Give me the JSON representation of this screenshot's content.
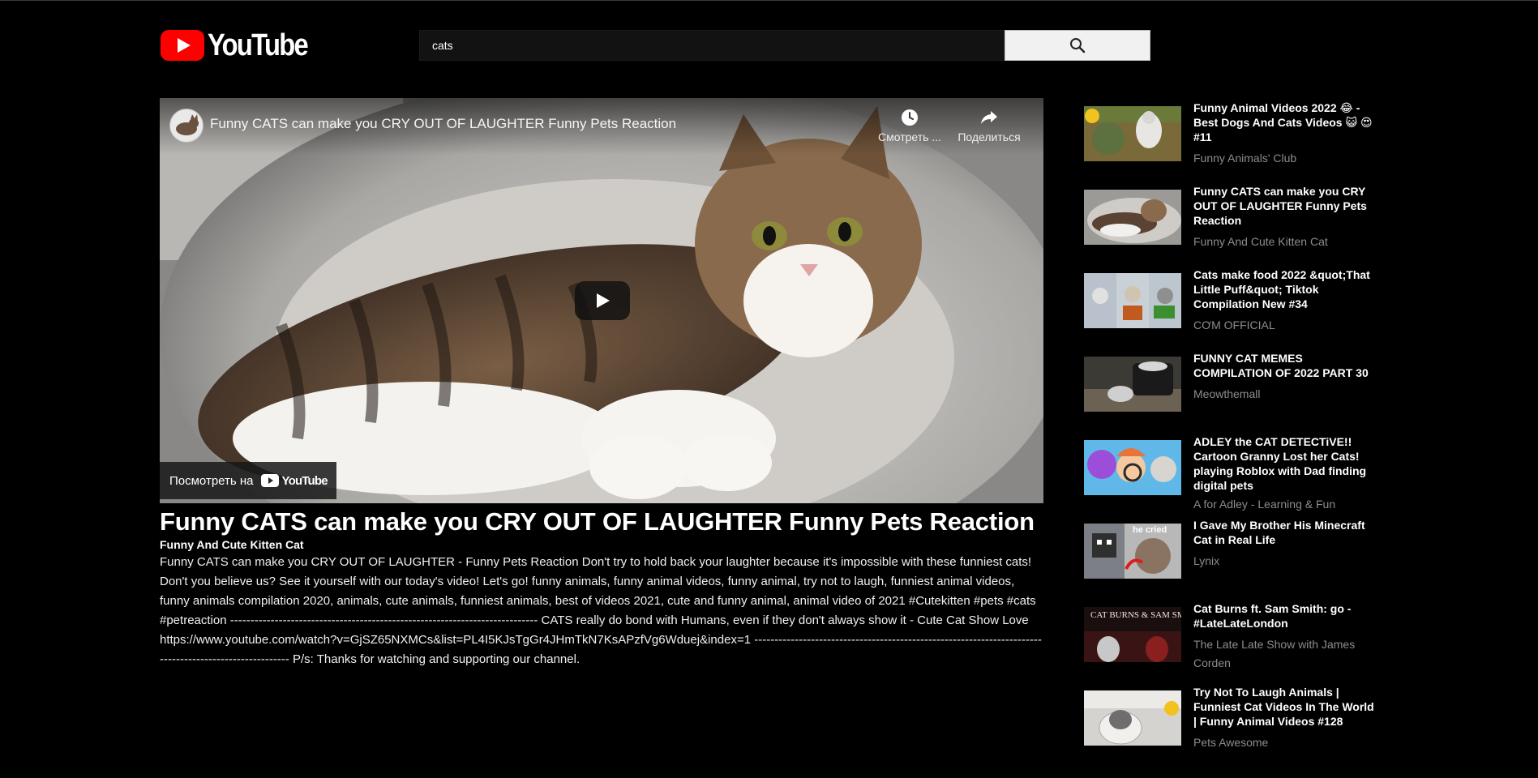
{
  "header": {
    "logo_text": "YouTube",
    "search_value": "cats"
  },
  "player": {
    "title": "Funny CATS can make you CRY OUT OF LAUGHTER Funny Pets Reaction",
    "watch_later_label": "Смотреть ...",
    "share_label": "Поделиться",
    "watch_on_label": "Посмотреть на",
    "watch_on_logo": "YouTube"
  },
  "video": {
    "title": "Funny CATS can make you CRY OUT OF LAUGHTER Funny Pets Reaction",
    "channel": "Funny And Cute Kitten Cat",
    "description": "Funny CATS can make you CRY OUT OF LAUGHTER - Funny Pets Reaction Don't try to hold back your laughter because it's impossible with these funniest cats! Don't you believe us? See it yourself with our today's video! Let's go! funny animals, funny animal videos, funny animal, try not to laugh, funniest animal videos, funny animals compilation 2020, animals, cute animals, funniest animals, best of videos 2021, cute and funny animal, animal video of 2021 #Cutekitten #pets #cats #petreaction ---------------------------------------------------------------------------- CATS really do bond with Humans, even if they don't always show it - Cute Cat Show Love https://www.youtube.com/watch?v=GjSZ65NXMCs&list=PL4I5KJsTgGr4JHmTkN7KsAPzfVg6Wduej&index=1 ------------------------------------------------------------------------------------------------------- P/s: Thanks for watching and supporting our channel."
  },
  "sidebar": {
    "items": [
      {
        "title": "Funny Animal Videos 2022 😂 - Best Dogs And Cats Videos 😺 😍 #11",
        "channel": "Funny Animals' Club"
      },
      {
        "title": "Funny CATS can make you CRY OUT OF LAUGHTER Funny Pets Reaction",
        "channel": "Funny And Cute Kitten Cat"
      },
      {
        "title": "Cats make food 2022 &quot;That Little Puff&quot; Tiktok Compilation New #34",
        "channel": "CƠM OFFICIAL"
      },
      {
        "title": "FUNNY CAT MEMES COMPILATION OF 2022 PART 30",
        "channel": "Meowthemall"
      },
      {
        "title": "ADLEY the CAT DETECTiVE!! Cartoon Granny Lost her Cats! playing Roblox with Dad finding digital pets",
        "channel": "A for Adley - Learning & Fun"
      },
      {
        "title": "I Gave My Brother His Minecraft Cat in Real Life",
        "channel": "Lynix",
        "thumb_text": "he cried"
      },
      {
        "title": "Cat Burns ft. Sam Smith: go - #LateLateLondon",
        "channel": "The Late Late Show with James Corden",
        "thumb_text": "CAT BURNS & SAM SMITH"
      },
      {
        "title": "Try Not To Laugh Animals | Funniest Cat Videos In The World | Funny Animal Videos #128",
        "channel": "Pets Awesome"
      }
    ]
  },
  "colors": {
    "background": "#000000",
    "brand_red": "#FF0000",
    "muted_text": "#8c8c8c",
    "search_button": "#f1f1f1"
  },
  "icons": [
    "youtube-logo-icon",
    "search-icon",
    "clock-icon",
    "share-icon",
    "play-icon"
  ]
}
